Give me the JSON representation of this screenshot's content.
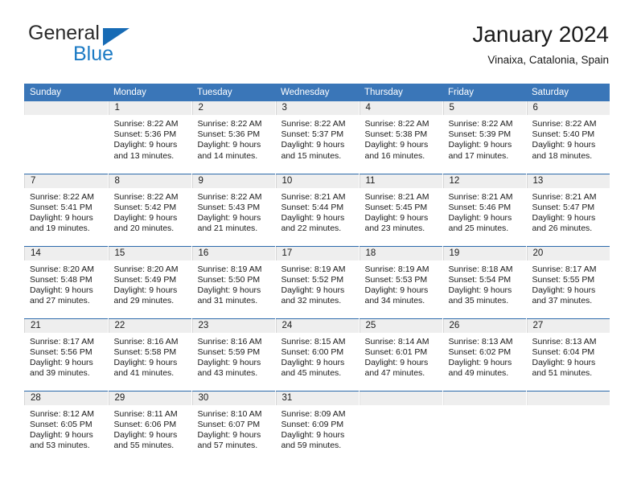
{
  "brand": {
    "name_top": "General",
    "name_bottom": "Blue",
    "triangle_color": "#176bb5",
    "blue_color": "#1b7ac4"
  },
  "header": {
    "title": "January 2024",
    "subtitle": "Vinaixa, Catalonia, Spain"
  },
  "theme": {
    "header_bg": "#3a76b8",
    "week_divider": "#2c6aab",
    "daynum_band_bg": "#eeeeee",
    "text": "#1a1a1a"
  },
  "weekdays": [
    "Sunday",
    "Monday",
    "Tuesday",
    "Wednesday",
    "Thursday",
    "Friday",
    "Saturday"
  ],
  "weeks": [
    [
      {
        "day": ""
      },
      {
        "day": "1",
        "sunrise": "Sunrise: 8:22 AM",
        "sunset": "Sunset: 5:36 PM",
        "daylight1": "Daylight: 9 hours",
        "daylight2": "and 13 minutes."
      },
      {
        "day": "2",
        "sunrise": "Sunrise: 8:22 AM",
        "sunset": "Sunset: 5:36 PM",
        "daylight1": "Daylight: 9 hours",
        "daylight2": "and 14 minutes."
      },
      {
        "day": "3",
        "sunrise": "Sunrise: 8:22 AM",
        "sunset": "Sunset: 5:37 PM",
        "daylight1": "Daylight: 9 hours",
        "daylight2": "and 15 minutes."
      },
      {
        "day": "4",
        "sunrise": "Sunrise: 8:22 AM",
        "sunset": "Sunset: 5:38 PM",
        "daylight1": "Daylight: 9 hours",
        "daylight2": "and 16 minutes."
      },
      {
        "day": "5",
        "sunrise": "Sunrise: 8:22 AM",
        "sunset": "Sunset: 5:39 PM",
        "daylight1": "Daylight: 9 hours",
        "daylight2": "and 17 minutes."
      },
      {
        "day": "6",
        "sunrise": "Sunrise: 8:22 AM",
        "sunset": "Sunset: 5:40 PM",
        "daylight1": "Daylight: 9 hours",
        "daylight2": "and 18 minutes."
      }
    ],
    [
      {
        "day": "7",
        "sunrise": "Sunrise: 8:22 AM",
        "sunset": "Sunset: 5:41 PM",
        "daylight1": "Daylight: 9 hours",
        "daylight2": "and 19 minutes."
      },
      {
        "day": "8",
        "sunrise": "Sunrise: 8:22 AM",
        "sunset": "Sunset: 5:42 PM",
        "daylight1": "Daylight: 9 hours",
        "daylight2": "and 20 minutes."
      },
      {
        "day": "9",
        "sunrise": "Sunrise: 8:22 AM",
        "sunset": "Sunset: 5:43 PM",
        "daylight1": "Daylight: 9 hours",
        "daylight2": "and 21 minutes."
      },
      {
        "day": "10",
        "sunrise": "Sunrise: 8:21 AM",
        "sunset": "Sunset: 5:44 PM",
        "daylight1": "Daylight: 9 hours",
        "daylight2": "and 22 minutes."
      },
      {
        "day": "11",
        "sunrise": "Sunrise: 8:21 AM",
        "sunset": "Sunset: 5:45 PM",
        "daylight1": "Daylight: 9 hours",
        "daylight2": "and 23 minutes."
      },
      {
        "day": "12",
        "sunrise": "Sunrise: 8:21 AM",
        "sunset": "Sunset: 5:46 PM",
        "daylight1": "Daylight: 9 hours",
        "daylight2": "and 25 minutes."
      },
      {
        "day": "13",
        "sunrise": "Sunrise: 8:21 AM",
        "sunset": "Sunset: 5:47 PM",
        "daylight1": "Daylight: 9 hours",
        "daylight2": "and 26 minutes."
      }
    ],
    [
      {
        "day": "14",
        "sunrise": "Sunrise: 8:20 AM",
        "sunset": "Sunset: 5:48 PM",
        "daylight1": "Daylight: 9 hours",
        "daylight2": "and 27 minutes."
      },
      {
        "day": "15",
        "sunrise": "Sunrise: 8:20 AM",
        "sunset": "Sunset: 5:49 PM",
        "daylight1": "Daylight: 9 hours",
        "daylight2": "and 29 minutes."
      },
      {
        "day": "16",
        "sunrise": "Sunrise: 8:19 AM",
        "sunset": "Sunset: 5:50 PM",
        "daylight1": "Daylight: 9 hours",
        "daylight2": "and 31 minutes."
      },
      {
        "day": "17",
        "sunrise": "Sunrise: 8:19 AM",
        "sunset": "Sunset: 5:52 PM",
        "daylight1": "Daylight: 9 hours",
        "daylight2": "and 32 minutes."
      },
      {
        "day": "18",
        "sunrise": "Sunrise: 8:19 AM",
        "sunset": "Sunset: 5:53 PM",
        "daylight1": "Daylight: 9 hours",
        "daylight2": "and 34 minutes."
      },
      {
        "day": "19",
        "sunrise": "Sunrise: 8:18 AM",
        "sunset": "Sunset: 5:54 PM",
        "daylight1": "Daylight: 9 hours",
        "daylight2": "and 35 minutes."
      },
      {
        "day": "20",
        "sunrise": "Sunrise: 8:17 AM",
        "sunset": "Sunset: 5:55 PM",
        "daylight1": "Daylight: 9 hours",
        "daylight2": "and 37 minutes."
      }
    ],
    [
      {
        "day": "21",
        "sunrise": "Sunrise: 8:17 AM",
        "sunset": "Sunset: 5:56 PM",
        "daylight1": "Daylight: 9 hours",
        "daylight2": "and 39 minutes."
      },
      {
        "day": "22",
        "sunrise": "Sunrise: 8:16 AM",
        "sunset": "Sunset: 5:58 PM",
        "daylight1": "Daylight: 9 hours",
        "daylight2": "and 41 minutes."
      },
      {
        "day": "23",
        "sunrise": "Sunrise: 8:16 AM",
        "sunset": "Sunset: 5:59 PM",
        "daylight1": "Daylight: 9 hours",
        "daylight2": "and 43 minutes."
      },
      {
        "day": "24",
        "sunrise": "Sunrise: 8:15 AM",
        "sunset": "Sunset: 6:00 PM",
        "daylight1": "Daylight: 9 hours",
        "daylight2": "and 45 minutes."
      },
      {
        "day": "25",
        "sunrise": "Sunrise: 8:14 AM",
        "sunset": "Sunset: 6:01 PM",
        "daylight1": "Daylight: 9 hours",
        "daylight2": "and 47 minutes."
      },
      {
        "day": "26",
        "sunrise": "Sunrise: 8:13 AM",
        "sunset": "Sunset: 6:02 PM",
        "daylight1": "Daylight: 9 hours",
        "daylight2": "and 49 minutes."
      },
      {
        "day": "27",
        "sunrise": "Sunrise: 8:13 AM",
        "sunset": "Sunset: 6:04 PM",
        "daylight1": "Daylight: 9 hours",
        "daylight2": "and 51 minutes."
      }
    ],
    [
      {
        "day": "28",
        "sunrise": "Sunrise: 8:12 AM",
        "sunset": "Sunset: 6:05 PM",
        "daylight1": "Daylight: 9 hours",
        "daylight2": "and 53 minutes."
      },
      {
        "day": "29",
        "sunrise": "Sunrise: 8:11 AM",
        "sunset": "Sunset: 6:06 PM",
        "daylight1": "Daylight: 9 hours",
        "daylight2": "and 55 minutes."
      },
      {
        "day": "30",
        "sunrise": "Sunrise: 8:10 AM",
        "sunset": "Sunset: 6:07 PM",
        "daylight1": "Daylight: 9 hours",
        "daylight2": "and 57 minutes."
      },
      {
        "day": "31",
        "sunrise": "Sunrise: 8:09 AM",
        "sunset": "Sunset: 6:09 PM",
        "daylight1": "Daylight: 9 hours",
        "daylight2": "and 59 minutes."
      },
      {
        "day": ""
      },
      {
        "day": ""
      },
      {
        "day": ""
      }
    ]
  ]
}
